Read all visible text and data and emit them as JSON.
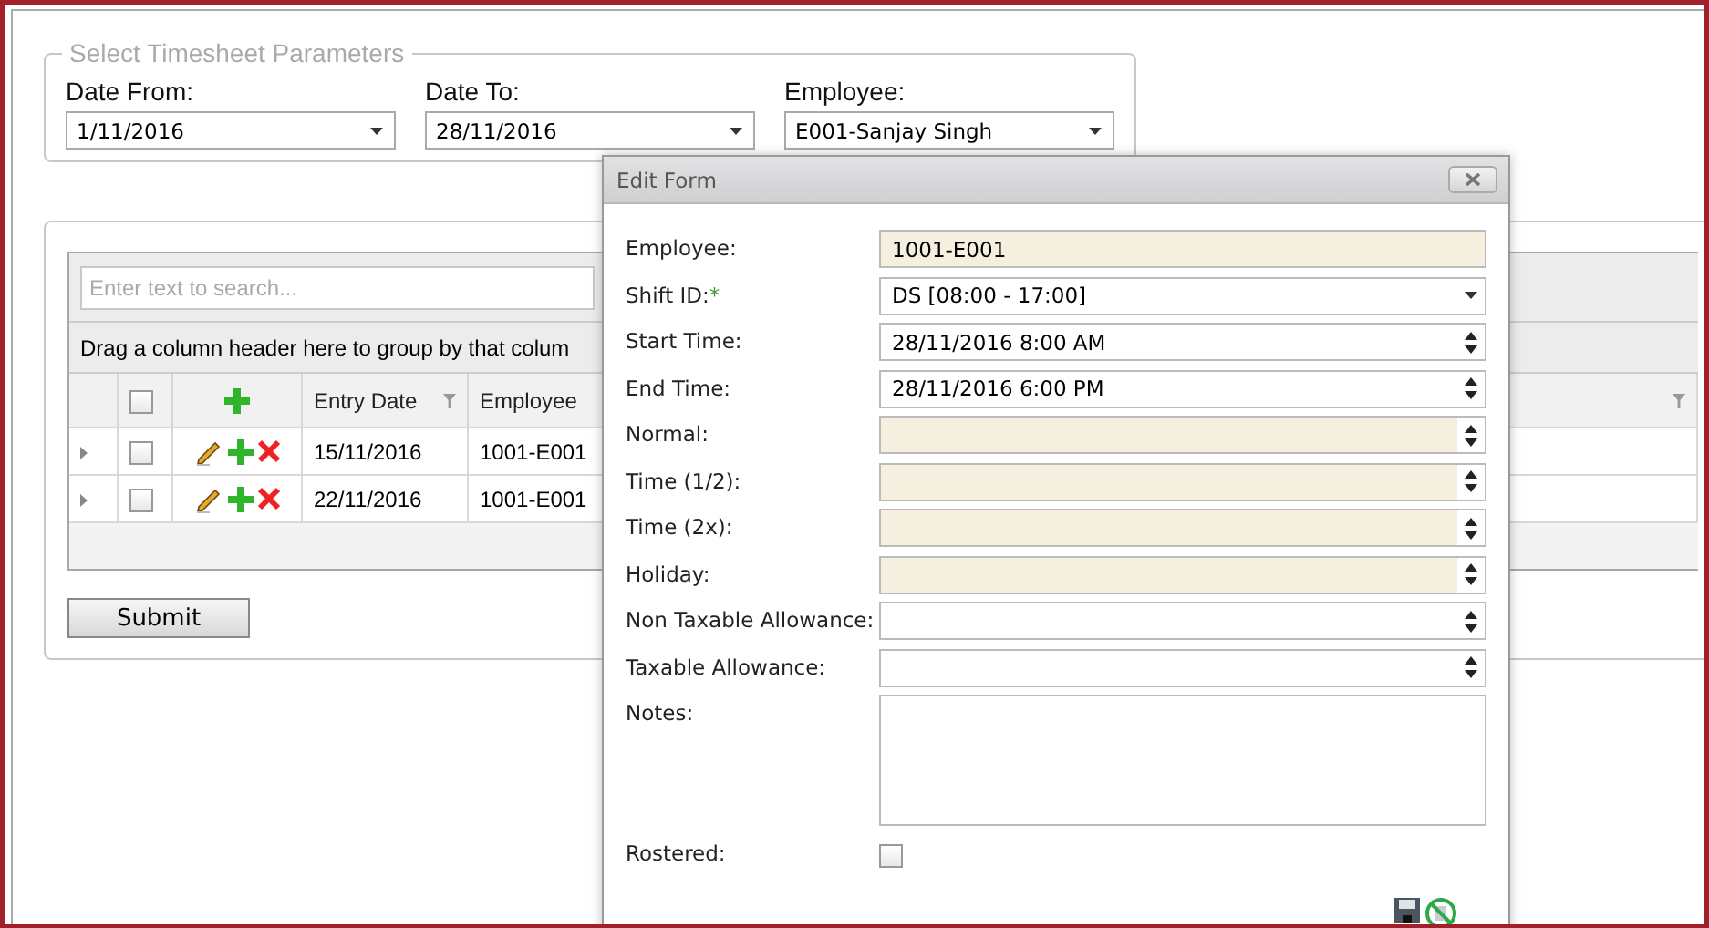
{
  "parameters": {
    "legend": "Select Timesheet Parameters",
    "fields": [
      {
        "label": "Date From:",
        "value": "1/11/2016"
      },
      {
        "label": "Date To:",
        "value": "28/11/2016"
      },
      {
        "label": "Employee:",
        "value": "E001-Sanjay Singh"
      }
    ]
  },
  "grid": {
    "search": {
      "placeholder": "Enter text to search..."
    },
    "group_panel": "Drag a column header here to group by that colum",
    "header_checked": false,
    "columns": [
      {
        "label": "Entry Date",
        "filter": true
      },
      {
        "label": "Employee",
        "filter": false
      }
    ],
    "rows": [
      {
        "checked": false,
        "cells": [
          "15/11/2016",
          "1001-E001"
        ]
      },
      {
        "checked": false,
        "cells": [
          "22/11/2016",
          "1001-E001"
        ]
      }
    ]
  },
  "submit": "Submit",
  "dialog": {
    "title": "Edit Form",
    "fields": [
      {
        "label": "Employee:",
        "kind": "text",
        "readonly": true,
        "value": "1001-E001"
      },
      {
        "label": "Shift ID:",
        "required_mark": "*",
        "kind": "dropdown",
        "readonly": false,
        "value": "DS [08:00 - 17:00]"
      },
      {
        "label": "Start Time:",
        "kind": "spinner",
        "readonly": false,
        "value": "28/11/2016 8:00 AM"
      },
      {
        "label": "End Time:",
        "kind": "spinner",
        "readonly": false,
        "value": "28/11/2016 6:00 PM"
      },
      {
        "label": "Normal:",
        "kind": "spinner",
        "readonly": true
      },
      {
        "label": "Time (1/2):",
        "kind": "spinner",
        "readonly": true
      },
      {
        "label": "Time (2x):",
        "kind": "spinner",
        "readonly": true
      },
      {
        "label": "Holiday:",
        "kind": "spinner",
        "readonly": true
      },
      {
        "label": "Non Taxable Allowance:",
        "kind": "spinner",
        "readonly": false
      },
      {
        "label": "Taxable Allowance:",
        "kind": "spinner",
        "readonly": false
      },
      {
        "label": "Notes:",
        "kind": "memo",
        "readonly": false
      },
      {
        "label": "Rostered:",
        "kind": "checkbox",
        "checked": false
      }
    ]
  }
}
